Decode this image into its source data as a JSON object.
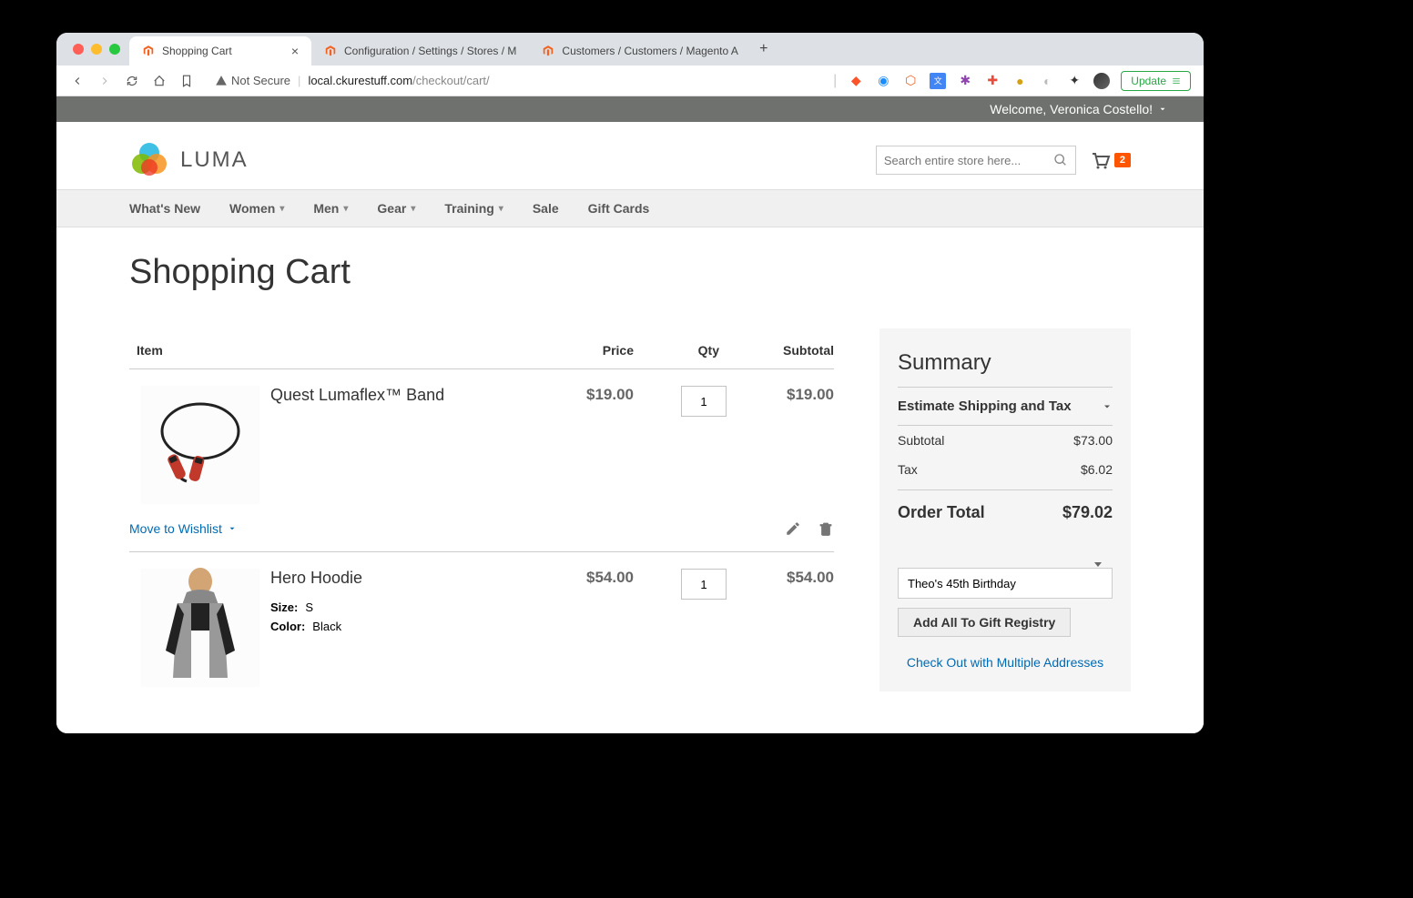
{
  "browser": {
    "tabs": [
      {
        "title": "Shopping Cart",
        "active": true
      },
      {
        "title": "Configuration / Settings / Stores / M"
      },
      {
        "title": "Customers / Customers / Magento A"
      }
    ],
    "url_warning": "Not Secure",
    "url_domain": "local.ckurestuff.com",
    "url_path": "/checkout/cart/",
    "update_label": "Update"
  },
  "header": {
    "welcome": "Welcome, Veronica Costello!",
    "logo_text": "LUMA",
    "search_placeholder": "Search entire store here...",
    "cart_count": "2"
  },
  "nav": {
    "items": [
      {
        "label": "What's New",
        "caret": false
      },
      {
        "label": "Women",
        "caret": true
      },
      {
        "label": "Men",
        "caret": true
      },
      {
        "label": "Gear",
        "caret": true
      },
      {
        "label": "Training",
        "caret": true
      },
      {
        "label": "Sale",
        "caret": false
      },
      {
        "label": "Gift Cards",
        "caret": false
      }
    ]
  },
  "page": {
    "title": "Shopping Cart",
    "table": {
      "th_item": "Item",
      "th_price": "Price",
      "th_qty": "Qty",
      "th_subtotal": "Subtotal"
    },
    "items": [
      {
        "name": "Quest Lumaflex™ Band",
        "price": "$19.00",
        "qty": "1",
        "subtotal": "$19.00",
        "attrs": []
      },
      {
        "name": "Hero Hoodie",
        "price": "$54.00",
        "qty": "1",
        "subtotal": "$54.00",
        "attrs": [
          {
            "label": "Size:",
            "value": "S"
          },
          {
            "label": "Color:",
            "value": "Black"
          }
        ]
      }
    ],
    "move_wishlist": "Move to Wishlist"
  },
  "summary": {
    "title": "Summary",
    "estimate_label": "Estimate Shipping and Tax",
    "subtotal_label": "Subtotal",
    "subtotal_value": "$73.00",
    "tax_label": "Tax",
    "tax_value": "$6.02",
    "total_label": "Order Total",
    "total_value": "$79.02",
    "registry_option": "Theo's 45th Birthday",
    "add_registry": "Add All To Gift Registry",
    "multi_addr": "Check Out with Multiple Addresses"
  }
}
